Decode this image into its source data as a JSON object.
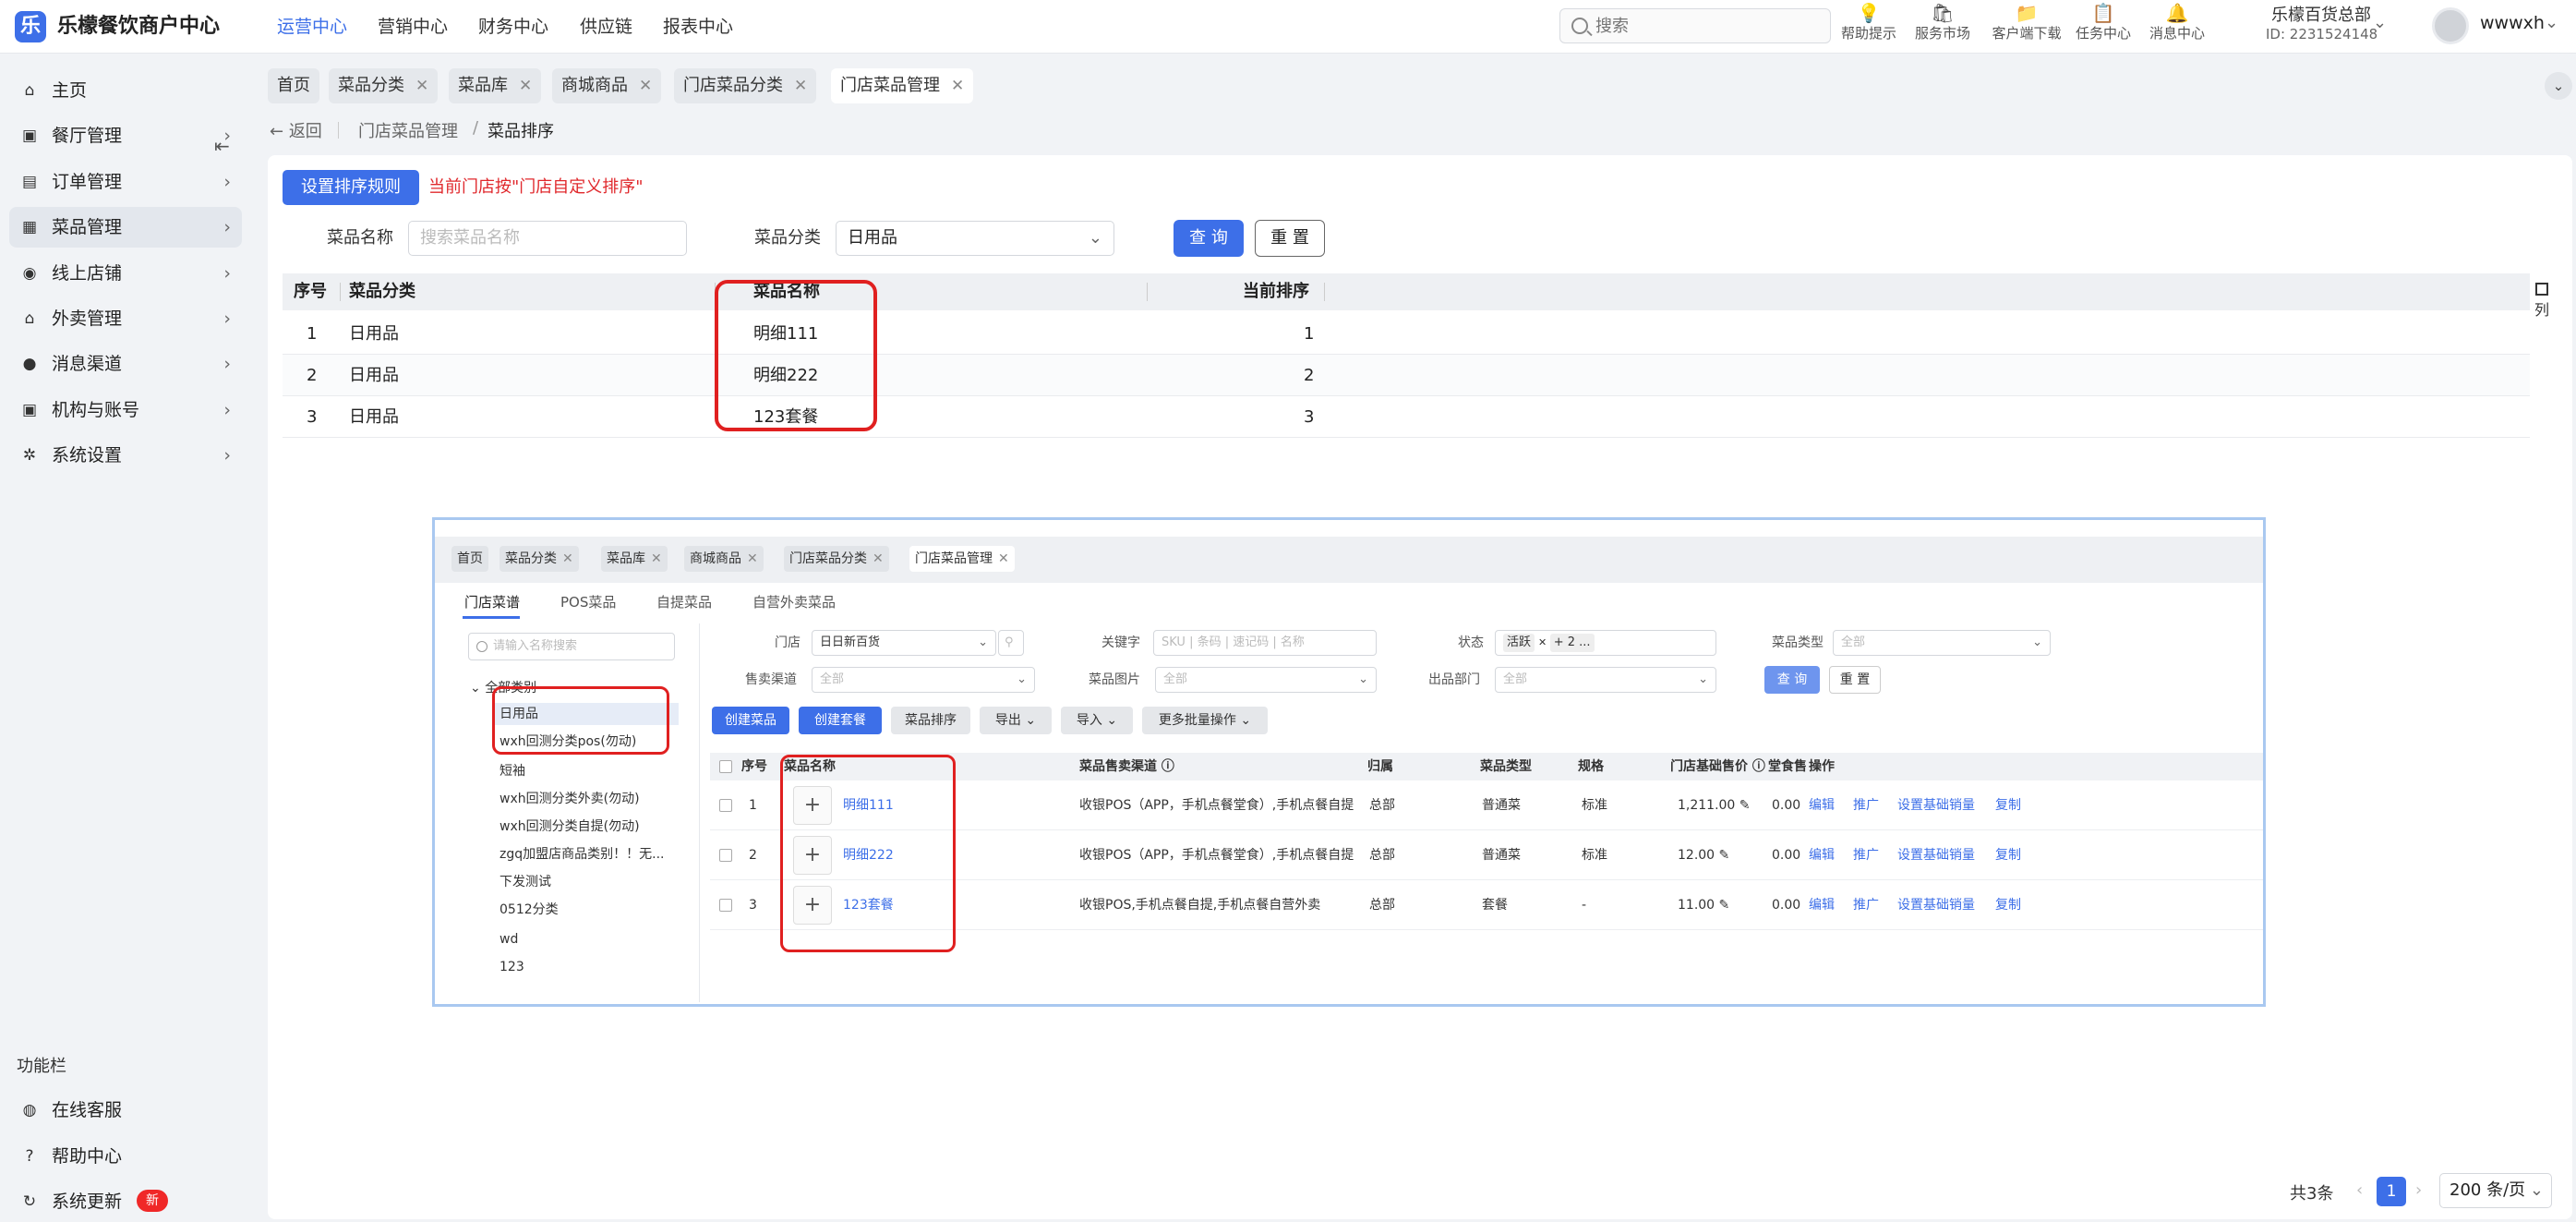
{
  "brand": {
    "name": "乐檬餐饮商户中心",
    "logo": "乐"
  },
  "topnav": [
    "运营中心",
    "营销中心",
    "财务中心",
    "供应链",
    "报表中心"
  ],
  "search": {
    "placeholder": "搜索"
  },
  "tools": [
    {
      "label": "帮助提示",
      "icon": "lightbulb-icon",
      "glyph": "💡"
    },
    {
      "label": "服务市场",
      "icon": "shop-icon",
      "glyph": "🛍"
    },
    {
      "label": "客户端下载",
      "icon": "folder-download-icon",
      "glyph": "📁"
    },
    {
      "label": "任务中心",
      "icon": "clipboard-icon",
      "glyph": "📋"
    },
    {
      "label": "消息中心",
      "icon": "bell-icon",
      "glyph": "🔔"
    }
  ],
  "account": {
    "name": "乐檬百货总部",
    "id": "ID: 2231524148"
  },
  "user": {
    "name": "wwwxh"
  },
  "sidebar": {
    "items": [
      {
        "label": "主页",
        "icon": "home-icon",
        "glyph": "⌂"
      },
      {
        "label": "餐厅管理",
        "icon": "store-icon",
        "glyph": "▣"
      },
      {
        "label": "订单管理",
        "icon": "order-icon",
        "glyph": "▤"
      },
      {
        "label": "菜品管理",
        "icon": "dish-icon",
        "glyph": "▦"
      },
      {
        "label": "线上店铺",
        "icon": "globe-icon",
        "glyph": "◉"
      },
      {
        "label": "外卖管理",
        "icon": "bank-icon",
        "glyph": "⌂"
      },
      {
        "label": "消息渠道",
        "icon": "chat-icon",
        "glyph": "●"
      },
      {
        "label": "机构与账号",
        "icon": "org-icon",
        "glyph": "▣"
      },
      {
        "label": "系统设置",
        "icon": "gear-icon",
        "glyph": "✲"
      }
    ],
    "func_title": "功能栏",
    "func_items": [
      {
        "label": "在线客服",
        "icon": "headset-icon",
        "glyph": "◍"
      },
      {
        "label": "帮助中心",
        "icon": "help-icon",
        "glyph": "?"
      },
      {
        "label": "系统更新",
        "icon": "refresh-icon",
        "glyph": "↻"
      }
    ],
    "new_badge": "新"
  },
  "tabs": [
    "首页",
    "菜品分类",
    "菜品库",
    "商城商品",
    "门店菜品分类",
    "门店菜品管理"
  ],
  "breadcrumb": {
    "back": "返回",
    "parent": "门店菜品管理",
    "sep": "/",
    "current": "菜品排序"
  },
  "toolbar": {
    "sort_rule_button": "设置排序规则",
    "sort_note": "当前门店按\"门店自定义排序\""
  },
  "filters": {
    "name_label": "菜品名称",
    "name_placeholder": "搜索菜品名称",
    "category_label": "菜品分类",
    "category_value": "日用品",
    "query_button": "查 询",
    "reset_button": "重 置"
  },
  "table": {
    "headers": [
      "序号",
      "菜品分类",
      "菜品名称",
      "当前排序"
    ],
    "rows": [
      {
        "index": "1",
        "category": "日用品",
        "name": "明细111",
        "sort": "1"
      },
      {
        "index": "2",
        "category": "日用品",
        "name": "明细222",
        "sort": "2"
      },
      {
        "index": "3",
        "category": "日用品",
        "name": "123套餐",
        "sort": "3"
      }
    ],
    "column_toggle": "列"
  },
  "pagination": {
    "total": "共3条",
    "page": "1",
    "page_size": "200 条/页"
  },
  "inset": {
    "tabs": [
      "首页",
      "菜品分类",
      "菜品库",
      "商城商品",
      "门店菜品分类",
      "门店菜品管理"
    ],
    "subtabs": [
      "门店菜谱",
      "POS菜品",
      "自提菜品",
      "自营外卖菜品"
    ],
    "tree_search_placeholder": "请输入名称搜索",
    "tree_root": "全部类别",
    "tree_items": [
      "日用品",
      "wxh回测分类pos(勿动)",
      "短袖",
      "wxh回测分类外卖(勿动)",
      "wxh回测分类自提(勿动)",
      "zgq加盟店商品类别！！无...",
      "下发测试",
      "0512分类",
      "wd",
      "123"
    ],
    "filters": {
      "store_label": "门店",
      "store_value": "日日新百货",
      "keyword_label": "关键字",
      "keyword_placeholder": "SKU | 条码 | 速记码 | 名称",
      "status_label": "状态",
      "status_chip": "活跃",
      "status_more": "+ 2 ...",
      "dish_type_label": "菜品类型",
      "dish_type_value": "全部",
      "channel_label": "售卖渠道",
      "channel_value": "全部",
      "image_label": "菜品图片",
      "image_value": "全部",
      "dept_label": "出品部门",
      "dept_value": "全部",
      "query": "查 询",
      "reset": "重 置"
    },
    "actions": [
      "创建菜品",
      "创建套餐",
      "菜品排序",
      "导出",
      "导入",
      "更多批量操作"
    ],
    "headers": [
      "序号",
      "菜品名称",
      "菜品售卖渠道",
      "归属",
      "菜品类型",
      "规格",
      "门店基础售价",
      "堂食售",
      "操作"
    ],
    "rows": [
      {
        "index": "1",
        "name": "明细111",
        "channel": "收银POS（APP，手机点餐堂食）,手机点餐自提",
        "owner": "总部",
        "type": "普通菜",
        "spec": "标准",
        "price": "1,211.00",
        "dine": "0.00"
      },
      {
        "index": "2",
        "name": "明细222",
        "channel": "收银POS（APP，手机点餐堂食）,手机点餐自提",
        "owner": "总部",
        "type": "普通菜",
        "spec": "标准",
        "price": "12.00",
        "dine": "0.00"
      },
      {
        "index": "3",
        "name": "123套餐",
        "channel": "收银POS,手机点餐自提,手机点餐自营外卖",
        "owner": "总部",
        "type": "套餐",
        "spec": "-",
        "price": "11.00",
        "dine": "0.00"
      }
    ],
    "row_ops": [
      "编辑",
      "推广",
      "设置基础销量",
      "复制"
    ]
  },
  "colors": {
    "accent": "#3d6fe8",
    "warning": "#e0282c",
    "highlight": "#e02020"
  }
}
